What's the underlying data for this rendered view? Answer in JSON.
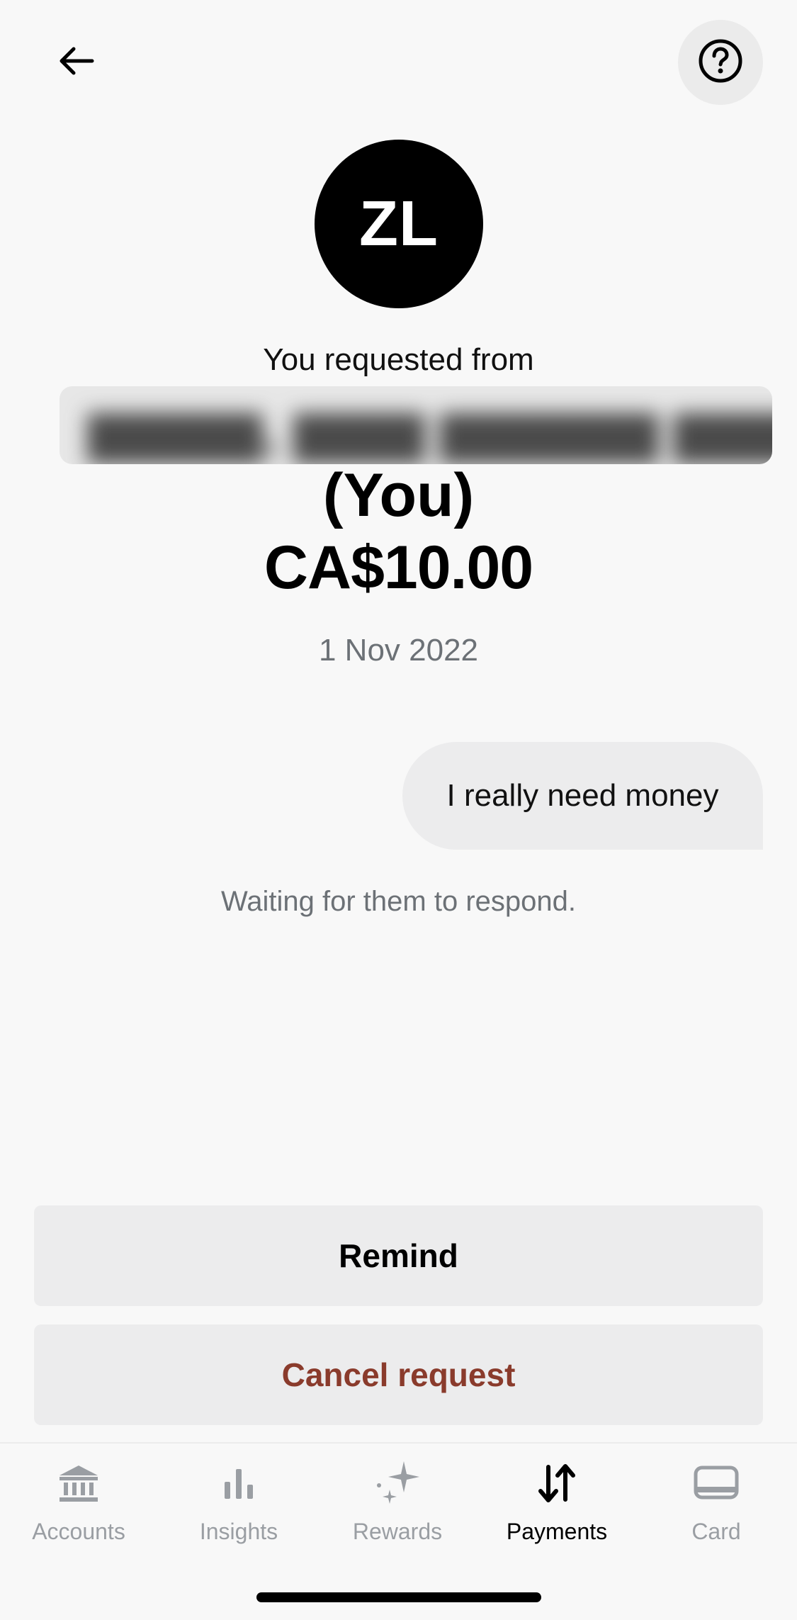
{
  "header": {
    "back_icon": "arrow-left-icon",
    "help_icon": "question-circle-icon"
  },
  "request": {
    "avatar_initials": "ZL",
    "requested_from_label": "You requested from",
    "recipient_suffix": "(You)",
    "amount": "CA$10.00",
    "date": "1 Nov 2022",
    "message": "I really need money",
    "status": "Waiting for them to respond."
  },
  "actions": {
    "remind_label": "Remind",
    "cancel_label": "Cancel request",
    "cancel_color": "#8a3b2c"
  },
  "tabs": [
    {
      "label": "Accounts",
      "icon": "bank-icon",
      "active": false
    },
    {
      "label": "Insights",
      "icon": "bar-chart-icon",
      "active": false
    },
    {
      "label": "Rewards",
      "icon": "sparkle-icon",
      "active": false
    },
    {
      "label": "Payments",
      "icon": "transfer-arrows-icon",
      "active": true
    },
    {
      "label": "Card",
      "icon": "card-icon",
      "active": false
    }
  ]
}
